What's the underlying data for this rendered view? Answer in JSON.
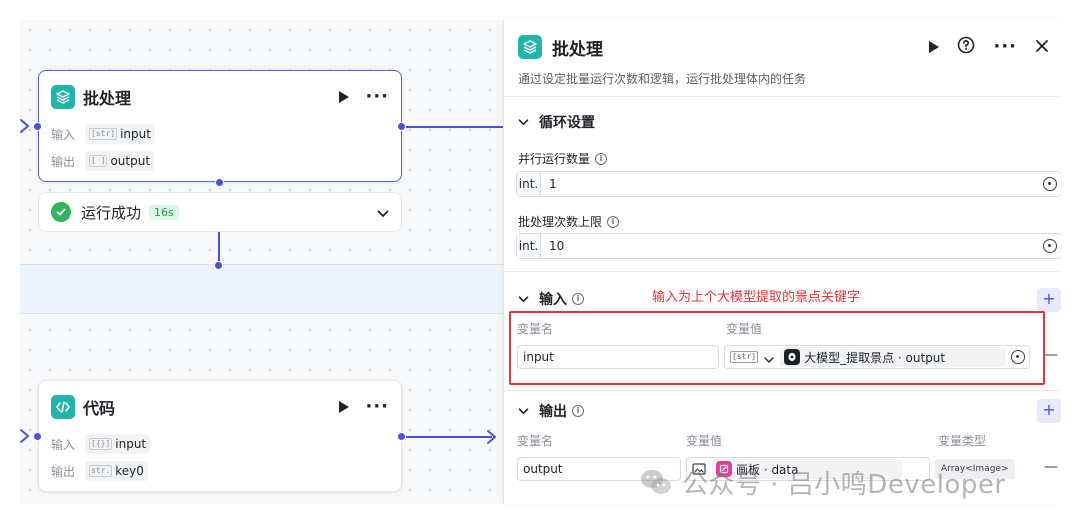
{
  "canvas": {
    "batch_node": {
      "title": "批处理",
      "input_label": "输入",
      "input_type": "[str]",
      "input_name": "input",
      "output_label": "输出",
      "output_type": "[ ]",
      "output_name": "output"
    },
    "status": {
      "text": "运行成功",
      "time": "16s"
    },
    "code_node": {
      "title": "代码",
      "input_label": "输入",
      "input_type": "[{}]",
      "input_name": "input",
      "output_label": "输出",
      "output_type": "str.",
      "output_name": "key0"
    }
  },
  "panel": {
    "title": "批处理",
    "description": "通过设定批量运行次数和逻辑，运行批处理体内的任务",
    "loop_section": "循环设置",
    "concurrency_label": "并行运行数量",
    "concurrency_type": "int.",
    "concurrency_value": "1",
    "batch_limit_label": "批处理次数上限",
    "batch_limit_type": "int.",
    "batch_limit_value": "10",
    "input_section": "输入",
    "input_annotation": "输入为上个大模型提取的景点关键字",
    "input_col_name": "变量名",
    "input_col_value": "变量值",
    "input_var_name": "input",
    "input_ref_type": "[str]",
    "input_ref_value": "大模型_提取景点 · output",
    "output_section": "输出",
    "output_col_name": "变量名",
    "output_col_value": "变量值",
    "output_col_type": "变量类型",
    "output_var_name": "output",
    "output_ref_value": "画板 · data",
    "output_var_type": "Array<Image>",
    "add": "+",
    "remove": "—"
  },
  "watermark": "公众号 · 吕小鸣Developer",
  "colors": {
    "accent": "#4b50e0",
    "node_icon": "#1fb5a8",
    "success": "#2fb55e",
    "annotation": "#e8333a"
  }
}
